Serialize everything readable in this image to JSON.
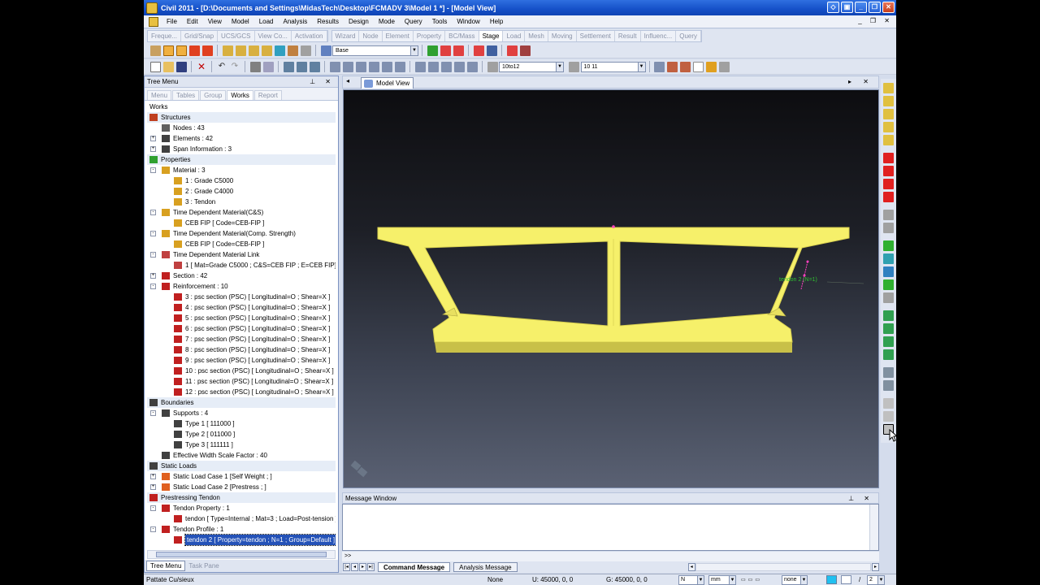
{
  "window": {
    "title": "Civil 2011 - [D:\\Documents and Settings\\MidasTech\\Desktop\\FCMADV 3\\Model 1 *] - [Model View]"
  },
  "menu": [
    "File",
    "Edit",
    "View",
    "Model",
    "Load",
    "Analysis",
    "Results",
    "Design",
    "Mode",
    "Query",
    "Tools",
    "Window",
    "Help"
  ],
  "mode_tabs_left": [
    "Freque...",
    "Grid/Snap",
    "UCS/GCS",
    "View Co...",
    "Activation"
  ],
  "mode_tabs_right": [
    "Wizard",
    "Node",
    "Element",
    "Property",
    "BC/Mass",
    "Stage",
    "Load",
    "Mesh",
    "Moving",
    "Settlement",
    "Result",
    "Influenc...",
    "Query"
  ],
  "active_mode_tab": "Stage",
  "toolbar": {
    "stage_combo": "Base",
    "combo_from": "10to12",
    "combo_to": "10 11"
  },
  "tree_panel": {
    "title": "Tree Menu",
    "tabs": [
      "Menu",
      "Tables",
      "Group",
      "Works",
      "Report"
    ],
    "active_tab": "Works",
    "rows": [
      {
        "text": "Works",
        "level": 0,
        "exp": "",
        "icon": "",
        "section": false
      },
      {
        "text": "Structures",
        "level": 0,
        "exp": "",
        "icon": "structure",
        "section": true
      },
      {
        "text": "Nodes : 43",
        "level": 1,
        "exp": "",
        "icon": "node",
        "section": false
      },
      {
        "text": "Elements : 42",
        "level": 1,
        "exp": "+",
        "icon": "element",
        "section": false
      },
      {
        "text": "Span Information : 3",
        "level": 1,
        "exp": "+",
        "icon": "span",
        "section": false
      },
      {
        "text": "Properties",
        "level": 0,
        "exp": "",
        "icon": "property",
        "section": true
      },
      {
        "text": "Material : 3",
        "level": 1,
        "exp": "-",
        "icon": "material",
        "section": false
      },
      {
        "text": "1 : Grade C5000",
        "level": 2,
        "exp": "",
        "icon": "material",
        "section": false
      },
      {
        "text": "2 : Grade C4000",
        "level": 2,
        "exp": "",
        "icon": "material",
        "section": false
      },
      {
        "text": "3 : Tendon",
        "level": 2,
        "exp": "",
        "icon": "material",
        "section": false
      },
      {
        "text": "Time Dependent Material(C&S)",
        "level": 1,
        "exp": "-",
        "icon": "material",
        "section": false
      },
      {
        "text": "CEB FIP [ Code=CEB-FIP ]",
        "level": 2,
        "exp": "",
        "icon": "material",
        "section": false
      },
      {
        "text": "Time Dependent Material(Comp. Strength)",
        "level": 1,
        "exp": "-",
        "icon": "material",
        "section": false
      },
      {
        "text": "CEB FIP [ Code=CEB-FIP ]",
        "level": 2,
        "exp": "",
        "icon": "material",
        "section": false
      },
      {
        "text": "Time Dependent Material Link",
        "level": 1,
        "exp": "-",
        "icon": "link",
        "section": false
      },
      {
        "text": "1 [ Mat=Grade C5000 ; C&S=CEB FIP ; E=CEB FIP]",
        "level": 2,
        "exp": "",
        "icon": "link",
        "section": false
      },
      {
        "text": "Section : 42",
        "level": 1,
        "exp": "+",
        "icon": "section",
        "section": false
      },
      {
        "text": "Reinforcement : 10",
        "level": 1,
        "exp": "-",
        "icon": "rebar",
        "section": false
      },
      {
        "text": "3 : psc section (PSC) [ Longitudinal=O ; Shear=X ]",
        "level": 2,
        "exp": "",
        "icon": "rebar",
        "section": false
      },
      {
        "text": "4 : psc section (PSC) [ Longitudinal=O ; Shear=X ]",
        "level": 2,
        "exp": "",
        "icon": "rebar",
        "section": false
      },
      {
        "text": "5 : psc section (PSC) [ Longitudinal=O ; Shear=X ]",
        "level": 2,
        "exp": "",
        "icon": "rebar",
        "section": false
      },
      {
        "text": "6 : psc section (PSC) [ Longitudinal=O ; Shear=X ]",
        "level": 2,
        "exp": "",
        "icon": "rebar",
        "section": false
      },
      {
        "text": "7 : psc section (PSC) [ Longitudinal=O ; Shear=X ]",
        "level": 2,
        "exp": "",
        "icon": "rebar",
        "section": false
      },
      {
        "text": "8 : psc section (PSC) [ Longitudinal=O ; Shear=X ]",
        "level": 2,
        "exp": "",
        "icon": "rebar",
        "section": false
      },
      {
        "text": "9 : psc section (PSC) [ Longitudinal=O ; Shear=X ]",
        "level": 2,
        "exp": "",
        "icon": "rebar",
        "section": false
      },
      {
        "text": "10 : psc section (PSC) [ Longitudinal=O ; Shear=X ]",
        "level": 2,
        "exp": "",
        "icon": "rebar",
        "section": false
      },
      {
        "text": "11 : psc section (PSC) [ Longitudinal=O ; Shear=X ]",
        "level": 2,
        "exp": "",
        "icon": "rebar",
        "section": false
      },
      {
        "text": "12 : psc section (PSC) [ Longitudinal=O ; Shear=X ]",
        "level": 2,
        "exp": "",
        "icon": "rebar",
        "section": false
      },
      {
        "text": "Boundaries",
        "level": 0,
        "exp": "",
        "icon": "boundary",
        "section": true
      },
      {
        "text": "Supports : 4",
        "level": 1,
        "exp": "-",
        "icon": "support",
        "section": false
      },
      {
        "text": "Type 1 [ 111000 ]",
        "level": 2,
        "exp": "",
        "icon": "support",
        "section": false
      },
      {
        "text": "Type 2 [ 011000 ]",
        "level": 2,
        "exp": "",
        "icon": "support",
        "section": false
      },
      {
        "text": "Type 3 [ 111111 ]",
        "level": 2,
        "exp": "",
        "icon": "support",
        "section": false
      },
      {
        "text": "Effective Width Scale Factor : 40",
        "level": 1,
        "exp": "",
        "icon": "width",
        "section": false
      },
      {
        "text": "Static Loads",
        "level": 0,
        "exp": "",
        "icon": "load",
        "section": true
      },
      {
        "text": "Static Load Case 1 [Self Weight ; ]",
        "level": 1,
        "exp": "+",
        "icon": "loadcase",
        "section": false
      },
      {
        "text": "Static Load Case 2 [Prestress ; ]",
        "level": 1,
        "exp": "+",
        "icon": "loadcase",
        "section": false
      },
      {
        "text": "Prestressing Tendon",
        "level": 0,
        "exp": "",
        "icon": "tendon",
        "section": true
      },
      {
        "text": "Tendon Property : 1",
        "level": 1,
        "exp": "-",
        "icon": "tendon",
        "section": false
      },
      {
        "text": "tendon [ Type=Internal ; Mat=3 ; Load=Post-tension ]",
        "level": 2,
        "exp": "",
        "icon": "tendon",
        "section": false
      },
      {
        "text": "Tendon Profile : 1",
        "level": 1,
        "exp": "-",
        "icon": "tendon",
        "section": false
      },
      {
        "text": "tendon 2 [ Property=tendon ; N=1 ; Group=Default ]",
        "level": 2,
        "exp": "",
        "icon": "tendon",
        "section": false,
        "selected": true
      }
    ],
    "bottom_tabs": [
      "Tree Menu",
      "Task Pane"
    ],
    "active_bottom_tab": "Tree Menu"
  },
  "model_view": {
    "tab_label": "Model View",
    "tendon_label": "tendon 2 (N=1)",
    "colors": {
      "section_fill": "#f6f06a",
      "section_shade": "#c8c048",
      "tendon": "#ff40c0",
      "tendon_label": "#30c030"
    }
  },
  "message_window": {
    "title": "Message Window",
    "prompt": ">>",
    "tabs": [
      "Command Message",
      "Analysis Message"
    ],
    "active_tab": "Command Message"
  },
  "status_bar": {
    "help": "Pattate Cu/sieux",
    "selection": "None",
    "ucs_coord": "U: 45000, 0, 0",
    "gcs_coord": "G: 45000, 0, 0",
    "force_unit": "N",
    "length_unit": "mm",
    "filter": "none",
    "page": "2"
  },
  "icons": {
    "toolbar1": [
      "snap-node-icon",
      "snap-line-icon",
      "snap-grid-icon",
      "snap-point-icon",
      "snap-element-icon",
      "snap-mid-icon",
      "snap-all-icon",
      "ucs-xy-icon",
      "ucs-xz-icon",
      "ucs-yz-icon",
      "view-point-icon",
      "view-all-icon",
      "layer-icon"
    ],
    "toolbar2": [
      "new-file-icon",
      "open-file-icon",
      "save-icon",
      "close-icon",
      "undo-icon",
      "redo-icon",
      "print-icon",
      "preview-icon"
    ]
  }
}
